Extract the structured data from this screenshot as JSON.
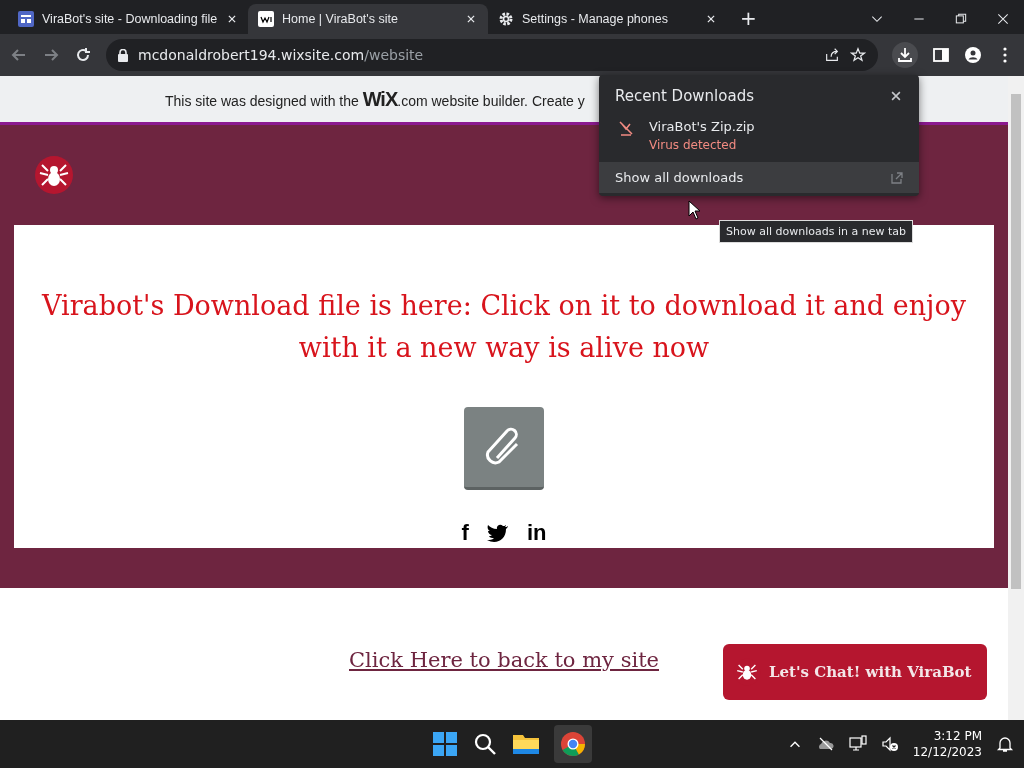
{
  "tabs": [
    {
      "title": "ViraBot's site - Downloading file",
      "kind": "site",
      "selected": false
    },
    {
      "title": "Home | ViraBot's site",
      "kind": "wix",
      "selected": true
    },
    {
      "title": "Settings - Manage phones",
      "kind": "gear",
      "selected": false
    }
  ],
  "new_tab": "+",
  "address_bar": {
    "host": "mcdonaldrobert194.wixsite.com",
    "path": "/website"
  },
  "wix_banner": {
    "text": "This site was designed with the **WiX**.com website builder. Create y"
  },
  "page": {
    "headline": "Virabot's Download file is here: Click on it to download it and enjoy with it a new way is alive now",
    "social": [
      {
        "kind": "facebook",
        "glyph": "f"
      },
      {
        "kind": "twitter"
      },
      {
        "kind": "linkedin",
        "glyph": "in"
      }
    ],
    "back_link": "Click Here to back to my site",
    "chat_button": "Let's Chat! with ViraBot"
  },
  "downloads_popup": {
    "title": "Recent Downloads",
    "items": [
      {
        "name": "ViraBot's Zip.zip",
        "status": "Virus detected"
      }
    ],
    "show_all": "Show all downloads",
    "tooltip": "Show all downloads in a new tab"
  },
  "taskbar": {
    "time": "3:12 PM",
    "date": "12/12/2023"
  }
}
